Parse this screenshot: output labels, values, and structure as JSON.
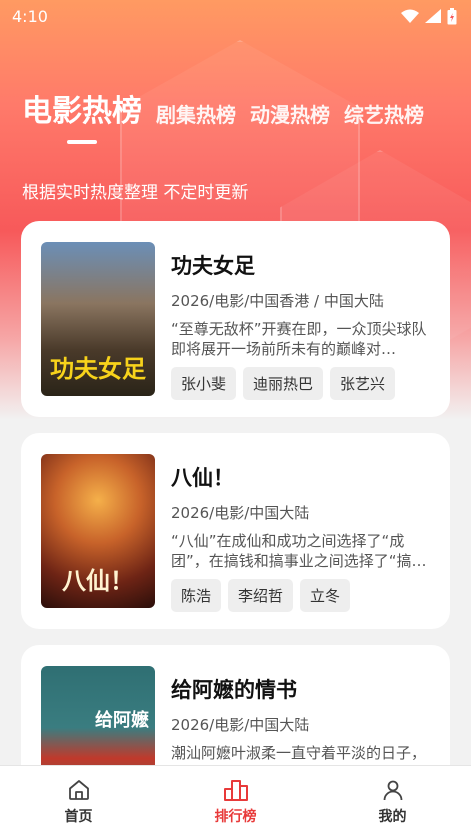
{
  "status_bar": {
    "time": "4:10"
  },
  "tabs": [
    {
      "label": "电影热榜",
      "active": true
    },
    {
      "label": "剧集热榜",
      "active": false
    },
    {
      "label": "动漫热榜",
      "active": false
    },
    {
      "label": "综艺热榜",
      "active": false
    }
  ],
  "subtitle": "根据实时热度整理 不定时更新",
  "movies": [
    {
      "title": "功夫女足",
      "meta": "2026/电影/中国香港 / 中国大陆",
      "description": "“至尊无敌杯”开赛在即，一众顶尖球队即将展开一场前所未有的巅峰对…",
      "tags": [
        "张小斐",
        "迪丽热巴",
        "张艺兴"
      ],
      "poster_text": "功夫女足"
    },
    {
      "title": "八仙！",
      "meta": "2026/电影/中国大陆",
      "description": "“八仙”在成仙和成功之间选择了“成团”，在搞钱和搞事业之间选择了“搞…",
      "tags": [
        "陈浩",
        "李绍哲",
        "立冬"
      ],
      "poster_text": "八仙！"
    },
    {
      "title": "给阿嬷的情书",
      "meta": "2026/电影/中国大陆",
      "description": "潮汕阿嬷叶淑柔一直守着平淡的日子，安享晚年。孙子晓伟因债务缠…",
      "tags": [],
      "poster_text": "给阿嬷"
    }
  ],
  "bottom_nav": [
    {
      "label": "首页",
      "icon": "home-icon",
      "active": false
    },
    {
      "label": "排行榜",
      "icon": "ranking-icon",
      "active": true
    },
    {
      "label": "我的",
      "icon": "user-icon",
      "active": false
    }
  ],
  "colors": {
    "accent": "#e83a3a",
    "hero_top": "#ff9a62",
    "hero_mid": "#f7595a"
  }
}
